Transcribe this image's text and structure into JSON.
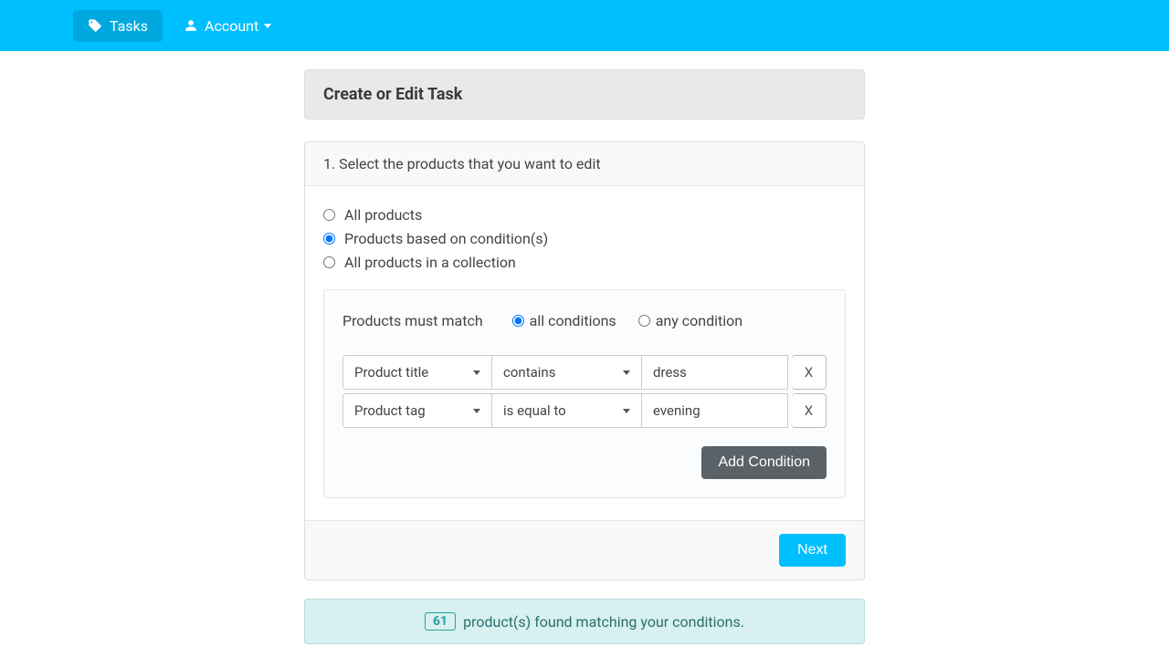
{
  "nav": {
    "tasks": "Tasks",
    "account": "Account"
  },
  "page_title": "Create or Edit Task",
  "step": {
    "heading": "1. Select the products that you want to edit"
  },
  "radios": {
    "all": "All products",
    "conditions": "Products based on condition(s)",
    "collection": "All products in a collection"
  },
  "match": {
    "label": "Products must match",
    "all": "all conditions",
    "any": "any condition"
  },
  "conditions": [
    {
      "field": "Product title",
      "operator": "contains",
      "value": "dress",
      "remove": "X"
    },
    {
      "field": "Product tag",
      "operator": "is equal to",
      "value": "evening",
      "remove": "X"
    }
  ],
  "buttons": {
    "add_condition": "Add Condition",
    "next": "Next"
  },
  "results": {
    "count": "61",
    "text": "product(s) found matching your conditions."
  }
}
